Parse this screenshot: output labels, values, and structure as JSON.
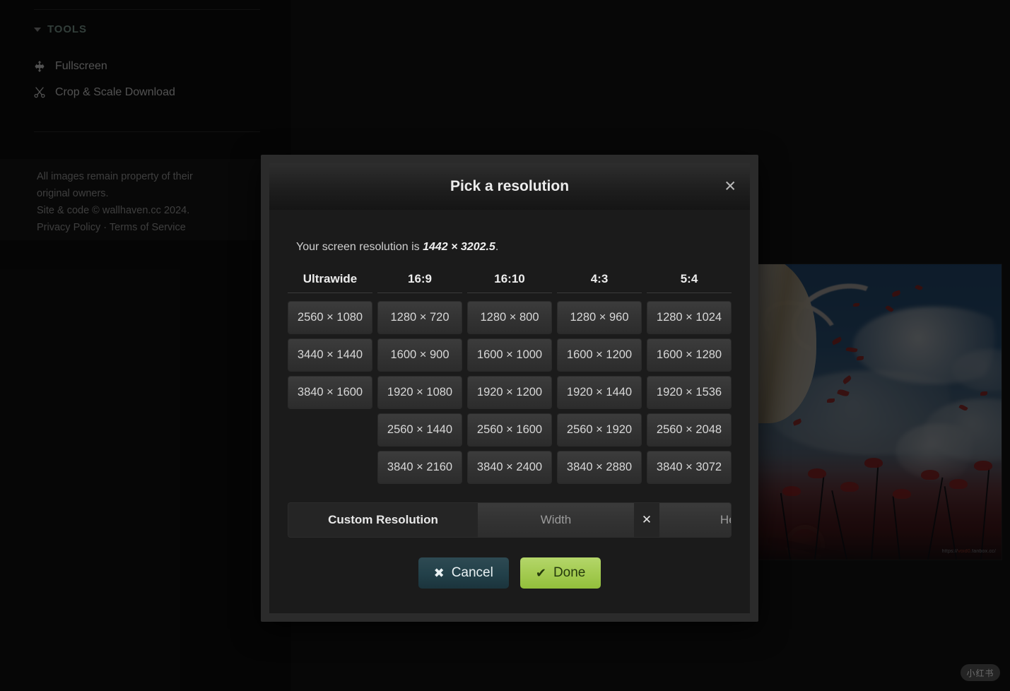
{
  "sidebar": {
    "tools_header": "TOOLS",
    "items": [
      {
        "label": "Fullscreen",
        "icon": "arrows-move-icon"
      },
      {
        "label": "Crop & Scale Download",
        "icon": "scissors-icon"
      }
    ],
    "footer": {
      "line1": "All images remain property of their",
      "line2": "original owners.",
      "line3": "Site & code © wallhaven.cc 2024.",
      "privacy": "Privacy Policy",
      "separator": " · ",
      "terms": "Terms of Service"
    }
  },
  "modal": {
    "title": "Pick a resolution",
    "close_label": "✕",
    "screen_res_prefix": "Your screen resolution is ",
    "screen_res_value": "1442 × 3202.5",
    "screen_res_suffix": ".",
    "columns": [
      "Ultrawide",
      "16:9",
      "16:10",
      "4:3",
      "5:4"
    ],
    "rows": [
      [
        "2560 × 1080",
        "1280 × 720",
        "1280 × 800",
        "1280 × 960",
        "1280 × 1024"
      ],
      [
        "3440 × 1440",
        "1600 × 900",
        "1600 × 1000",
        "1600 × 1200",
        "1600 × 1280"
      ],
      [
        "3840 × 1600",
        "1920 × 1080",
        "1920 × 1200",
        "1920 × 1440",
        "1920 × 1536"
      ],
      [
        "",
        "2560 × 1440",
        "2560 × 1600",
        "2560 × 1920",
        "2560 × 2048"
      ],
      [
        "",
        "3840 × 2160",
        "3840 × 2400",
        "3840 × 2880",
        "3840 × 3072"
      ]
    ],
    "custom": {
      "label": "Custom Resolution",
      "width_placeholder": "Width",
      "width_value": "",
      "separator": "✕",
      "height_placeholder": "Height",
      "height_value": ""
    },
    "cancel_label": "Cancel",
    "cancel_glyph": "✖",
    "done_label": "Done",
    "done_glyph": "✔"
  },
  "wallpaper": {
    "watermark_prefix": "https://",
    "watermark_highlight": "void0",
    "watermark_suffix": ".fanbox.cc/"
  },
  "corner_badge": {
    "label": "小红书"
  },
  "colors": {
    "accent_teal": "#6f8a82",
    "done_green": "#a2ca4f",
    "cancel_teal": "#224049",
    "page_bg": "#0d0d0d",
    "modal_frame": "#2b2b2b",
    "modal_bg": "#1b1b1b"
  }
}
